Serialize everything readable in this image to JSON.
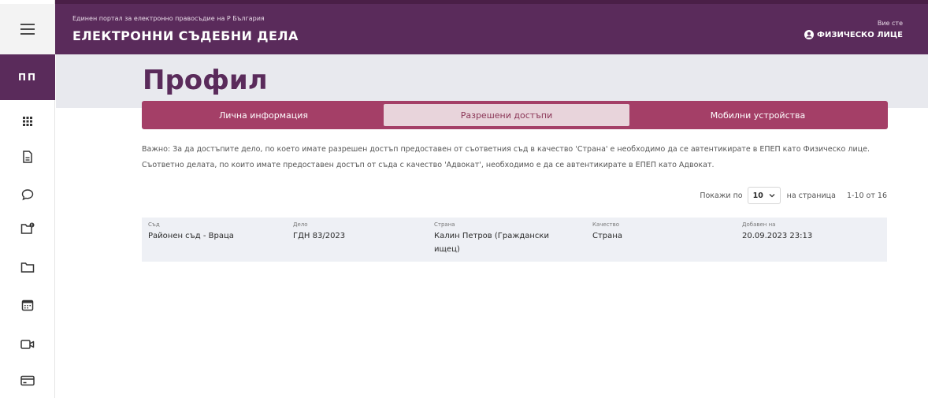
{
  "header": {
    "subtitle": "Единен портал за електронно правосъдие на Р България",
    "title": "ЕЛЕКТРОННИ СЪДЕБНИ ДЕЛА",
    "you_are": "Вие сте",
    "user_role": "ФИЗИЧЕСКО ЛИЦЕ"
  },
  "sidebar": {
    "initials": "ПП",
    "items": [
      "menu-icon",
      "grid-icon",
      "document-icon",
      "chat-icon",
      "folder-alert-icon",
      "folder-icon",
      "calendar-icon",
      "video-icon",
      "card-icon"
    ]
  },
  "page": {
    "title": "Профил"
  },
  "tabs": [
    {
      "label": "Лична информация",
      "active": false
    },
    {
      "label": "Разрешени достъпи",
      "active": true
    },
    {
      "label": "Мобилни устройства",
      "active": false
    }
  ],
  "notice": "Важно: За да достъпите дело, по което имате разрешен достъп предоставен от съответния съд в качество 'Страна' е необходимо да се автентикирате в ЕПЕП като Физическо лице. Съответно делата, по които имате предоставен достъп от съда с качество 'Адвокат', необходимо е да се автентикирате в ЕПЕП като Адвокат.",
  "pager": {
    "show_label": "Покажи по",
    "per_page": "10",
    "per_page_suffix": "на страница",
    "range": "1-10 от 16"
  },
  "table": {
    "columns": [
      "Съд",
      "Дело",
      "Страна",
      "Качество",
      "Добавен на"
    ],
    "rows": [
      {
        "court": "Районен съд - Враца",
        "case": "ГДН 83/2023",
        "party": "Калин Петров (Граждански ищец)",
        "capacity": "Страна",
        "added": "20.09.2023 23:13"
      }
    ]
  },
  "colors": {
    "header": "#5a2b5b",
    "tabs": "#a43f67",
    "active_tab": "#e8d4db",
    "band": "#e8e9ee",
    "row": "#eef0f5"
  }
}
